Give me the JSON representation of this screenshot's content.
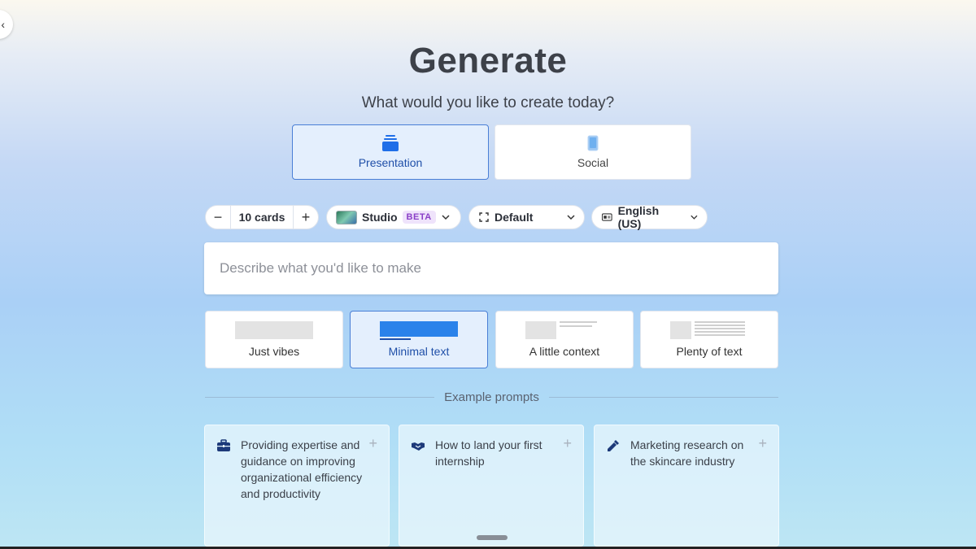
{
  "header": {
    "back_icon": "back-arrow-icon",
    "back_glyph": "‹",
    "title": "Generate",
    "subtitle": "What would you like to create today?"
  },
  "types": [
    {
      "label": "Presentation",
      "icon": "stack-icon",
      "selected": true
    },
    {
      "label": "Social",
      "icon": "phone-icon",
      "selected": false
    }
  ],
  "options": {
    "cards": {
      "minus": "−",
      "value": "10 cards",
      "plus": "+"
    },
    "theme": {
      "label": "Studio",
      "badge": "BETA"
    },
    "format": {
      "label": "Default"
    },
    "language": {
      "label": "English (US)"
    }
  },
  "prompt": {
    "placeholder": "Describe what you'd like to make",
    "value": ""
  },
  "density": [
    {
      "label": "Just vibes",
      "selected": false
    },
    {
      "label": "Minimal text",
      "selected": true
    },
    {
      "label": "A little context",
      "selected": false
    },
    {
      "label": "Plenty of text",
      "selected": false
    }
  ],
  "examples": {
    "heading": "Example prompts",
    "items": [
      {
        "text": "Providing expertise and guidance on improving organizational efficiency and productivity",
        "icon": "briefcase-icon"
      },
      {
        "text": "How to land your first internship",
        "icon": "handshake-icon"
      },
      {
        "text": "Marketing research on the skincare industry",
        "icon": "dropper-icon"
      }
    ],
    "plus_glyph": "+"
  },
  "colors": {
    "accent": "#1f6ee8",
    "selected_bg": "#e4effd",
    "selected_border": "#4a7fd6",
    "beta_bg": "#efe3fb",
    "beta_text": "#8a3fc7"
  }
}
